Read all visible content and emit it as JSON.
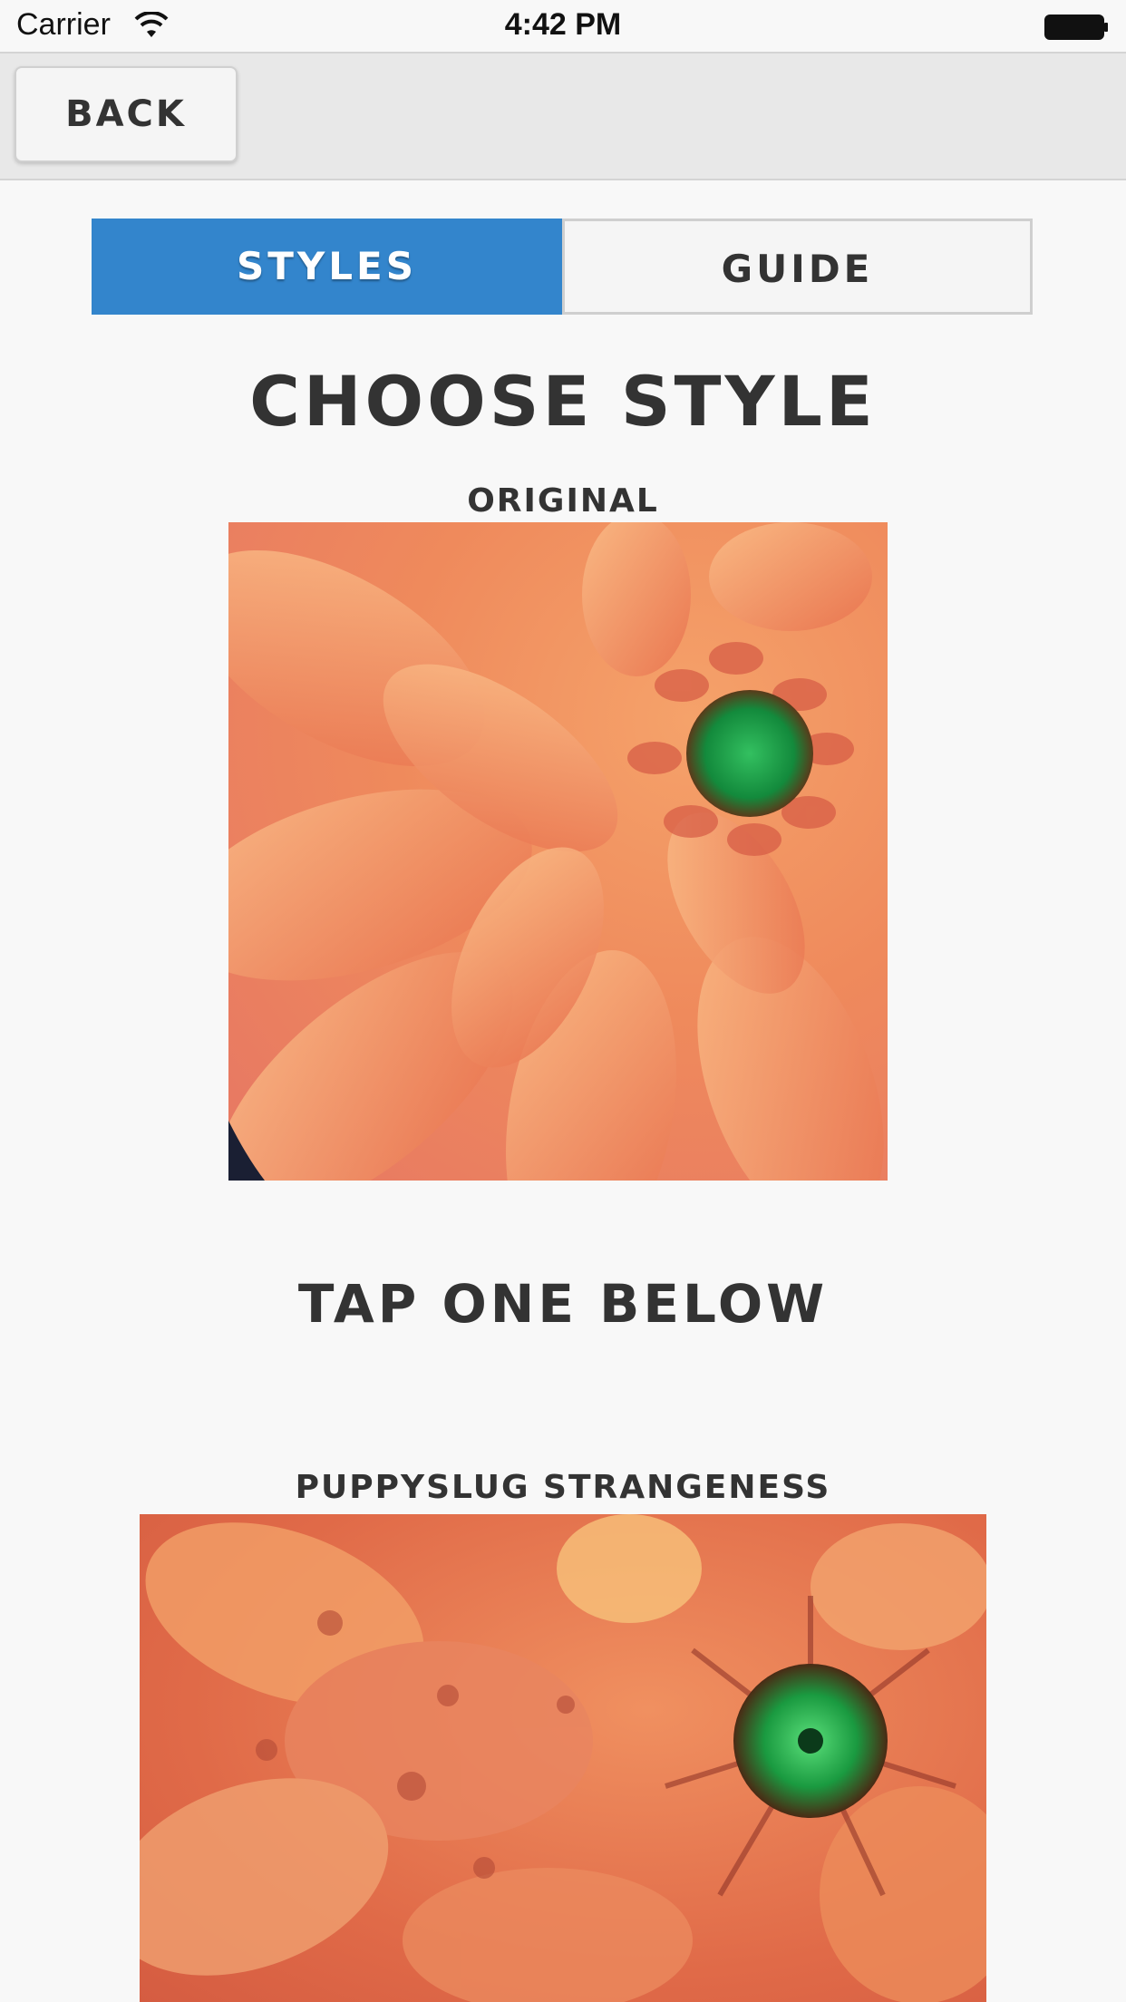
{
  "status_bar": {
    "carrier": "Carrier",
    "time": "4:42 PM",
    "icons": [
      "wifi-icon",
      "battery-icon"
    ]
  },
  "nav": {
    "back_label": "BACK"
  },
  "tabs": [
    {
      "label": "STYLES",
      "selected": true
    },
    {
      "label": "GUIDE",
      "selected": false
    }
  ],
  "main": {
    "title": "CHOOSE STYLE",
    "original_label": "ORIGINAL",
    "instruction": "TAP ONE BELOW",
    "styles": [
      {
        "label": "PUPPYSLUG STRANGENESS"
      }
    ]
  },
  "colors": {
    "accent": "#3385cc",
    "text": "#333333",
    "background": "#f8f8f8",
    "nav_background": "#e8e8e8",
    "flower_petal": "#f08a5a",
    "flower_center": "#1f9a4a"
  }
}
